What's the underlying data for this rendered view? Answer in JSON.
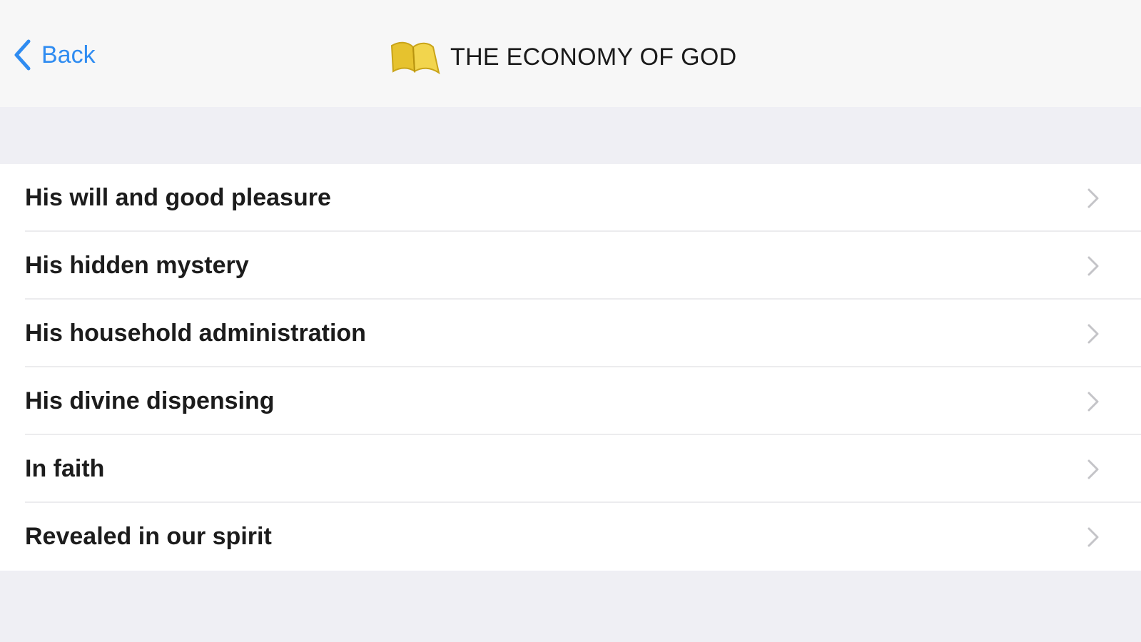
{
  "navbar": {
    "back_label": "Back",
    "title": "THE ECONOMY OF GOD",
    "back_icon": "chevron-left-icon",
    "title_icon": "open-book-icon",
    "accent_color": "#2f8cf1",
    "book_color": "#e6c22e"
  },
  "list": {
    "items": [
      {
        "label": "His will and good pleasure"
      },
      {
        "label": "His hidden mystery"
      },
      {
        "label": "His household administration"
      },
      {
        "label": "His divine dispensing"
      },
      {
        "label": "In faith"
      },
      {
        "label": "Revealed in our spirit"
      }
    ],
    "row_icon": "chevron-right-icon"
  }
}
